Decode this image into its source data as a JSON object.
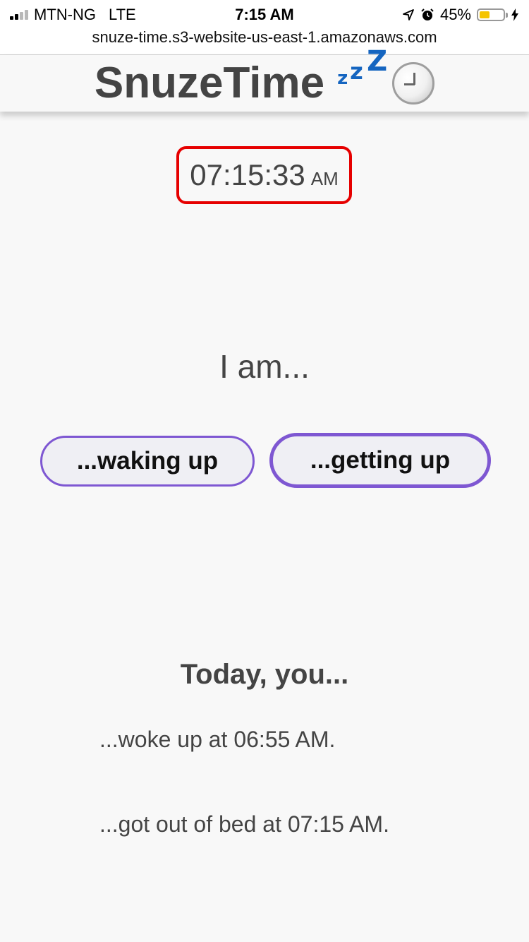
{
  "status_bar": {
    "carrier": "MTN-NG",
    "network": "LTE",
    "time": "7:15 AM",
    "battery_percent_label": "45%",
    "battery_level": 0.45,
    "battery_color": "#f5c400",
    "signal_bars_filled": 2,
    "signal_bars_total": 4,
    "icons": [
      "location-arrow-icon",
      "alarm-clock-icon",
      "charging-bolt-icon"
    ]
  },
  "browser": {
    "url": "snuze-time.s3-website-us-east-1.amazonaws.com"
  },
  "header": {
    "title": "SnuzeTime",
    "sleep_icon": "zzz-icon",
    "sleep_icon_glyphs": [
      "z",
      "z",
      "Z"
    ],
    "clock_icon": "clock-icon"
  },
  "clock": {
    "time": "07:15:33",
    "ampm": "AM",
    "border_color": "#e60000"
  },
  "main": {
    "prompt": "I am...",
    "buttons": {
      "waking_up": "...waking up",
      "getting_up": "...getting up"
    },
    "accent_color": "#7e57d2"
  },
  "today": {
    "heading": "Today, you...",
    "entries": [
      "...woke up at 06:55 AM.",
      "...got out of bed at 07:15 AM."
    ]
  }
}
